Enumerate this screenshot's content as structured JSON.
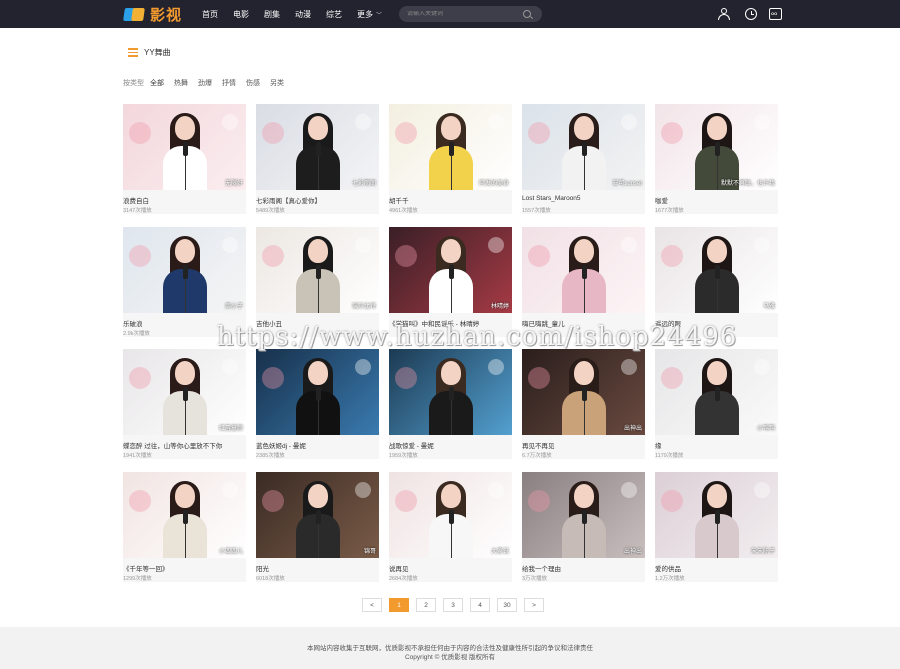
{
  "brand": {
    "name": "影视",
    "accent": "#f29a2e"
  },
  "nav": [
    {
      "label": "首页"
    },
    {
      "label": "电影"
    },
    {
      "label": "剧集"
    },
    {
      "label": "动漫"
    },
    {
      "label": "综艺"
    },
    {
      "label": "更多"
    }
  ],
  "search": {
    "placeholder": "请输入关键词"
  },
  "header_icons": [
    "user-icon",
    "clock-icon",
    "tv-icon"
  ],
  "section": {
    "title": "YY舞曲"
  },
  "filters": {
    "label": "按类型",
    "options": [
      "全部",
      "热舞",
      "劲爆",
      "抒情",
      "伤感",
      "另类"
    ]
  },
  "videos": [
    {
      "title": "浪费自白",
      "views": "3147次播放",
      "badge": "无限好"
    },
    {
      "title": "七彩雨阁【真心爱你】",
      "views": "5489次播放",
      "badge": "七彩雨阁"
    },
    {
      "title": "胡千千",
      "views": "4961次播放",
      "badge": "阿发的美食"
    },
    {
      "title": "Lost Stars_Maroon5",
      "views": "1557次播放",
      "badge": "安可sunset"
    },
    {
      "title": "咖爱",
      "views": "1677次播放",
      "badge": "默默不再联，也许我"
    },
    {
      "title": "乐破浪",
      "views": "2.9k次播放",
      "badge": "周小子"
    },
    {
      "title": "吉他小丑",
      "views": "",
      "badge": "瑞尔比特"
    },
    {
      "title": "《学猫叫》中和民谣乐 - 林晴婷",
      "views": "",
      "badge": "林晴婷"
    },
    {
      "title": "嗨已嗨跳_童儿",
      "views": "",
      "badge": ""
    },
    {
      "title": "遥远的眼",
      "views": "",
      "badge": "马雅"
    },
    {
      "title": "蝶恋醉 过往，山等你心里放不下你",
      "views": "1941次播放",
      "badge": "红唇童颜"
    },
    {
      "title": "蓝色妖姬dj - 曼妮",
      "views": "2385次播放",
      "badge": ""
    },
    {
      "title": "战歌惊爱 - 曼妮",
      "views": "1959次播放",
      "badge": ""
    },
    {
      "title": "再见不再见",
      "views": "6.7万次播放",
      "badge": "出神出"
    },
    {
      "title": "缘",
      "views": "1179次播放",
      "badge": "小鸭鸭"
    },
    {
      "title": "《千年等一回》",
      "views": "1299次播放",
      "badge": "小四四儿"
    },
    {
      "title": "阳光",
      "views": "6018次播放",
      "badge": "锦哥"
    },
    {
      "title": "说再见",
      "views": "2684次播放",
      "badge": "大家说"
    },
    {
      "title": "给我一个理由",
      "views": "3万次播放",
      "badge": "出神出"
    },
    {
      "title": "爱的供品",
      "views": "1.2万次播放",
      "badge": "朱朱陈子"
    }
  ],
  "pagination": {
    "prev": "<",
    "pages": [
      "1",
      "2",
      "3",
      "4",
      "30"
    ],
    "current": "1",
    "next": ">"
  },
  "footer": {
    "line1": "本网站内容收集于互联网，优质影视不承担任何由于内容的合法性及健康性所引起的争议和法律责任",
    "line2": "Copyright © 优质影视 版权所有"
  },
  "watermark": "https://www.huzhan.com/ishop24496"
}
